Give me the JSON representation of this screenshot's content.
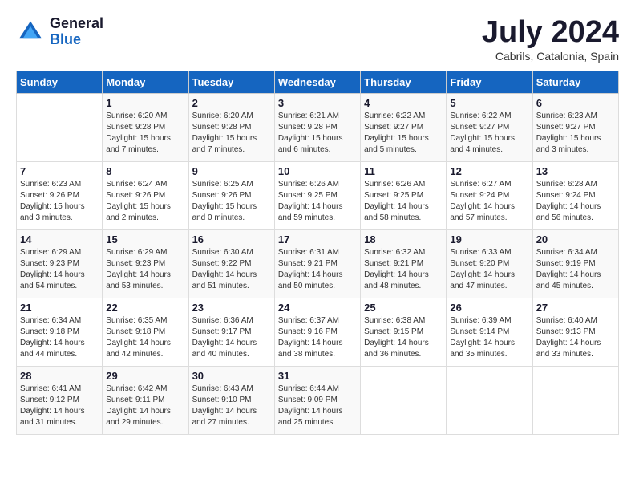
{
  "header": {
    "logo_line1": "General",
    "logo_line2": "Blue",
    "month_year": "July 2024",
    "location": "Cabrils, Catalonia, Spain"
  },
  "weekdays": [
    "Sunday",
    "Monday",
    "Tuesday",
    "Wednesday",
    "Thursday",
    "Friday",
    "Saturday"
  ],
  "weeks": [
    [
      {
        "day": "",
        "sunrise": "",
        "sunset": "",
        "daylight": ""
      },
      {
        "day": "1",
        "sunrise": "Sunrise: 6:20 AM",
        "sunset": "Sunset: 9:28 PM",
        "daylight": "Daylight: 15 hours and 7 minutes."
      },
      {
        "day": "2",
        "sunrise": "Sunrise: 6:20 AM",
        "sunset": "Sunset: 9:28 PM",
        "daylight": "Daylight: 15 hours and 7 minutes."
      },
      {
        "day": "3",
        "sunrise": "Sunrise: 6:21 AM",
        "sunset": "Sunset: 9:28 PM",
        "daylight": "Daylight: 15 hours and 6 minutes."
      },
      {
        "day": "4",
        "sunrise": "Sunrise: 6:22 AM",
        "sunset": "Sunset: 9:27 PM",
        "daylight": "Daylight: 15 hours and 5 minutes."
      },
      {
        "day": "5",
        "sunrise": "Sunrise: 6:22 AM",
        "sunset": "Sunset: 9:27 PM",
        "daylight": "Daylight: 15 hours and 4 minutes."
      },
      {
        "day": "6",
        "sunrise": "Sunrise: 6:23 AM",
        "sunset": "Sunset: 9:27 PM",
        "daylight": "Daylight: 15 hours and 3 minutes."
      }
    ],
    [
      {
        "day": "7",
        "sunrise": "Sunrise: 6:23 AM",
        "sunset": "Sunset: 9:26 PM",
        "daylight": "Daylight: 15 hours and 3 minutes."
      },
      {
        "day": "8",
        "sunrise": "Sunrise: 6:24 AM",
        "sunset": "Sunset: 9:26 PM",
        "daylight": "Daylight: 15 hours and 2 minutes."
      },
      {
        "day": "9",
        "sunrise": "Sunrise: 6:25 AM",
        "sunset": "Sunset: 9:26 PM",
        "daylight": "Daylight: 15 hours and 0 minutes."
      },
      {
        "day": "10",
        "sunrise": "Sunrise: 6:26 AM",
        "sunset": "Sunset: 9:25 PM",
        "daylight": "Daylight: 14 hours and 59 minutes."
      },
      {
        "day": "11",
        "sunrise": "Sunrise: 6:26 AM",
        "sunset": "Sunset: 9:25 PM",
        "daylight": "Daylight: 14 hours and 58 minutes."
      },
      {
        "day": "12",
        "sunrise": "Sunrise: 6:27 AM",
        "sunset": "Sunset: 9:24 PM",
        "daylight": "Daylight: 14 hours and 57 minutes."
      },
      {
        "day": "13",
        "sunrise": "Sunrise: 6:28 AM",
        "sunset": "Sunset: 9:24 PM",
        "daylight": "Daylight: 14 hours and 56 minutes."
      }
    ],
    [
      {
        "day": "14",
        "sunrise": "Sunrise: 6:29 AM",
        "sunset": "Sunset: 9:23 PM",
        "daylight": "Daylight: 14 hours and 54 minutes."
      },
      {
        "day": "15",
        "sunrise": "Sunrise: 6:29 AM",
        "sunset": "Sunset: 9:23 PM",
        "daylight": "Daylight: 14 hours and 53 minutes."
      },
      {
        "day": "16",
        "sunrise": "Sunrise: 6:30 AM",
        "sunset": "Sunset: 9:22 PM",
        "daylight": "Daylight: 14 hours and 51 minutes."
      },
      {
        "day": "17",
        "sunrise": "Sunrise: 6:31 AM",
        "sunset": "Sunset: 9:21 PM",
        "daylight": "Daylight: 14 hours and 50 minutes."
      },
      {
        "day": "18",
        "sunrise": "Sunrise: 6:32 AM",
        "sunset": "Sunset: 9:21 PM",
        "daylight": "Daylight: 14 hours and 48 minutes."
      },
      {
        "day": "19",
        "sunrise": "Sunrise: 6:33 AM",
        "sunset": "Sunset: 9:20 PM",
        "daylight": "Daylight: 14 hours and 47 minutes."
      },
      {
        "day": "20",
        "sunrise": "Sunrise: 6:34 AM",
        "sunset": "Sunset: 9:19 PM",
        "daylight": "Daylight: 14 hours and 45 minutes."
      }
    ],
    [
      {
        "day": "21",
        "sunrise": "Sunrise: 6:34 AM",
        "sunset": "Sunset: 9:18 PM",
        "daylight": "Daylight: 14 hours and 44 minutes."
      },
      {
        "day": "22",
        "sunrise": "Sunrise: 6:35 AM",
        "sunset": "Sunset: 9:18 PM",
        "daylight": "Daylight: 14 hours and 42 minutes."
      },
      {
        "day": "23",
        "sunrise": "Sunrise: 6:36 AM",
        "sunset": "Sunset: 9:17 PM",
        "daylight": "Daylight: 14 hours and 40 minutes."
      },
      {
        "day": "24",
        "sunrise": "Sunrise: 6:37 AM",
        "sunset": "Sunset: 9:16 PM",
        "daylight": "Daylight: 14 hours and 38 minutes."
      },
      {
        "day": "25",
        "sunrise": "Sunrise: 6:38 AM",
        "sunset": "Sunset: 9:15 PM",
        "daylight": "Daylight: 14 hours and 36 minutes."
      },
      {
        "day": "26",
        "sunrise": "Sunrise: 6:39 AM",
        "sunset": "Sunset: 9:14 PM",
        "daylight": "Daylight: 14 hours and 35 minutes."
      },
      {
        "day": "27",
        "sunrise": "Sunrise: 6:40 AM",
        "sunset": "Sunset: 9:13 PM",
        "daylight": "Daylight: 14 hours and 33 minutes."
      }
    ],
    [
      {
        "day": "28",
        "sunrise": "Sunrise: 6:41 AM",
        "sunset": "Sunset: 9:12 PM",
        "daylight": "Daylight: 14 hours and 31 minutes."
      },
      {
        "day": "29",
        "sunrise": "Sunrise: 6:42 AM",
        "sunset": "Sunset: 9:11 PM",
        "daylight": "Daylight: 14 hours and 29 minutes."
      },
      {
        "day": "30",
        "sunrise": "Sunrise: 6:43 AM",
        "sunset": "Sunset: 9:10 PM",
        "daylight": "Daylight: 14 hours and 27 minutes."
      },
      {
        "day": "31",
        "sunrise": "Sunrise: 6:44 AM",
        "sunset": "Sunset: 9:09 PM",
        "daylight": "Daylight: 14 hours and 25 minutes."
      },
      {
        "day": "",
        "sunrise": "",
        "sunset": "",
        "daylight": ""
      },
      {
        "day": "",
        "sunrise": "",
        "sunset": "",
        "daylight": ""
      },
      {
        "day": "",
        "sunrise": "",
        "sunset": "",
        "daylight": ""
      }
    ]
  ]
}
